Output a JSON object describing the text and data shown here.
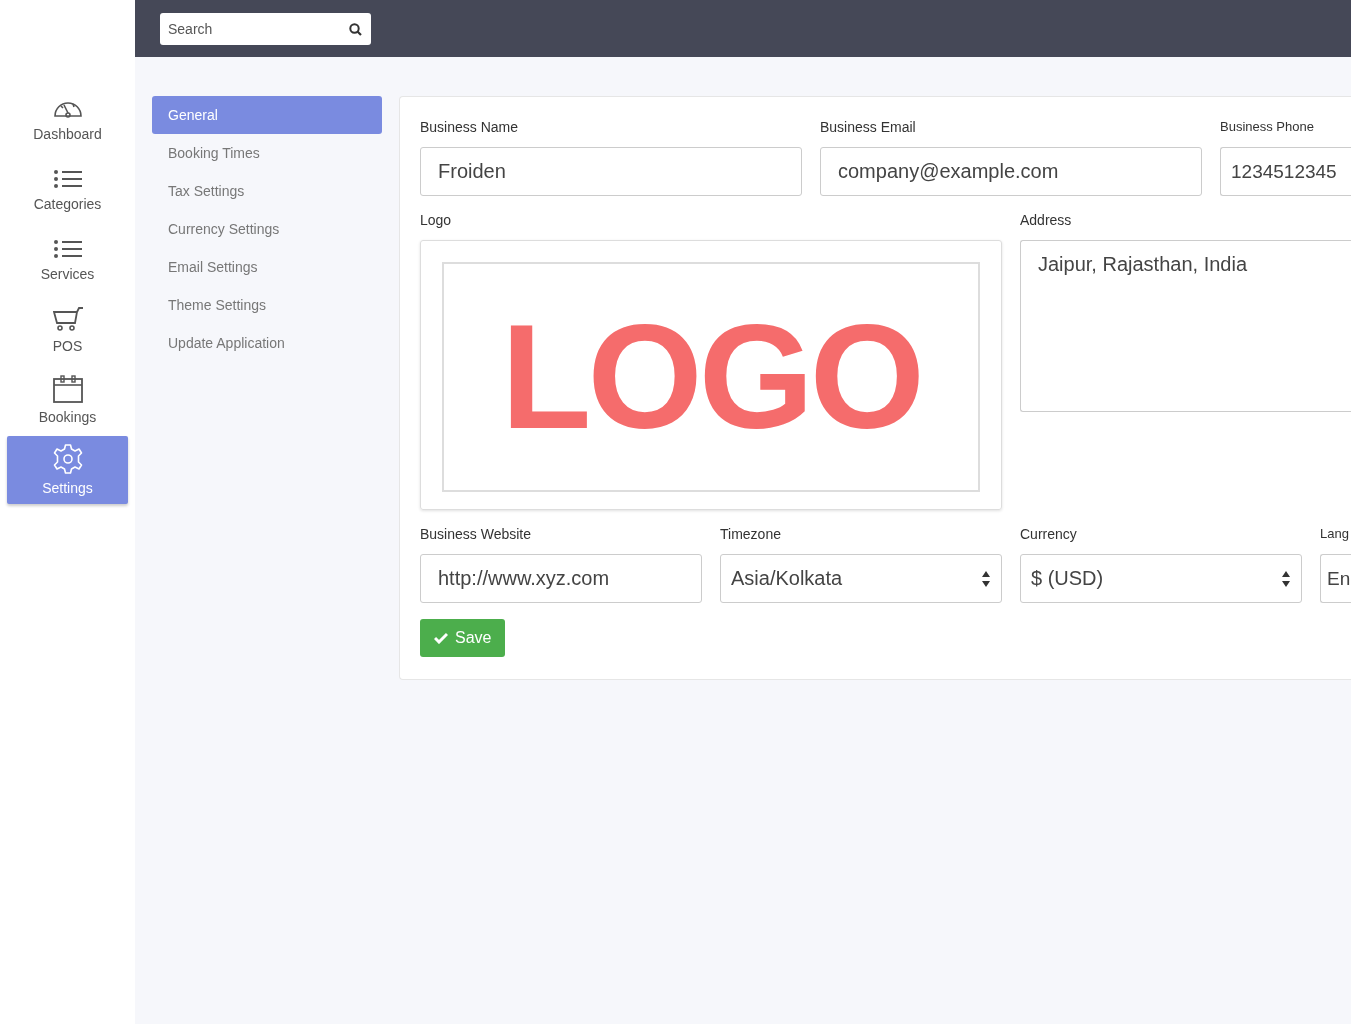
{
  "search": {
    "placeholder": "Search"
  },
  "nav": [
    {
      "label": "Dashboard",
      "kind": "gauge",
      "selected": false
    },
    {
      "label": "Categories",
      "kind": "list",
      "selected": false
    },
    {
      "label": "Services",
      "kind": "list",
      "selected": false
    },
    {
      "label": "POS",
      "kind": "cart",
      "selected": false
    },
    {
      "label": "Bookings",
      "kind": "calendar",
      "selected": false
    },
    {
      "label": "Settings",
      "kind": "gear",
      "selected": true
    }
  ],
  "settings_menu": [
    {
      "label": "General",
      "selected": true
    },
    {
      "label": "Booking Times",
      "selected": false
    },
    {
      "label": "Tax Settings",
      "selected": false
    },
    {
      "label": "Currency Settings",
      "selected": false
    },
    {
      "label": "Email Settings",
      "selected": false
    },
    {
      "label": "Theme Settings",
      "selected": false
    },
    {
      "label": "Update Application",
      "selected": false
    }
  ],
  "form": {
    "top_fields": [
      {
        "label": "Business Name",
        "kind": "text",
        "value": "Froiden"
      },
      {
        "label": "Business Email",
        "kind": "text",
        "value": "company@example.com"
      },
      {
        "label": "Business Phone",
        "kind": "text",
        "value": "1234512345"
      }
    ],
    "logo": {
      "label": "Logo",
      "text": "LOGO"
    },
    "address": {
      "label": "Address",
      "value": "Jaipur, Rajasthan, India"
    },
    "bottom_fields": [
      {
        "label": "Business Website",
        "kind": "text",
        "value": "http://www.xyz.com"
      },
      {
        "label": "Timezone",
        "kind": "select",
        "value": "Asia/Kolkata"
      },
      {
        "label": "Currency",
        "kind": "select",
        "value": "$ (USD)"
      },
      {
        "label": "Lang",
        "kind": "text",
        "value": "En"
      }
    ],
    "save": "Save"
  }
}
